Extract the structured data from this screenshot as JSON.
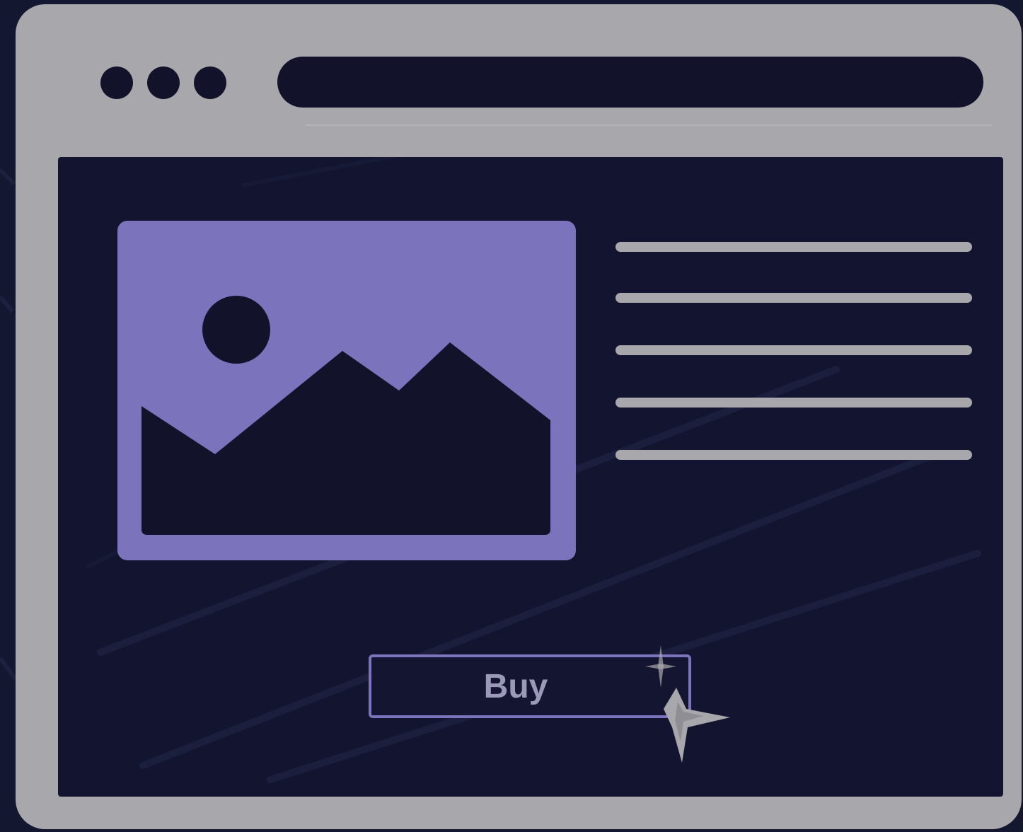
{
  "window": {
    "controls": [
      "dot-1",
      "dot-2",
      "dot-3"
    ],
    "address_bar": {
      "value": ""
    }
  },
  "content": {
    "image": {
      "icon": "image-placeholder-icon"
    },
    "text_lines": [
      1,
      2,
      3,
      4,
      5
    ],
    "buy_button": {
      "label": "Buy"
    }
  },
  "cursor": {
    "icon": "sparkle-cursor-icon"
  },
  "colors": {
    "page_background": "#141730",
    "window_frame": "#a8a8ac",
    "content_background": "#131530",
    "accent": "#7b74bd",
    "dark": "#12132b",
    "button_text": "#9b99b8"
  }
}
